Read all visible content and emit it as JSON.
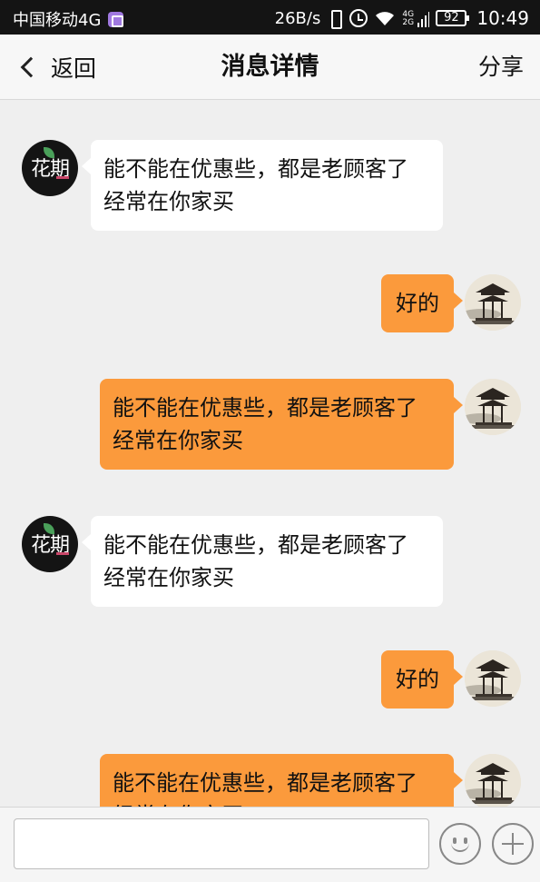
{
  "status_bar": {
    "carrier": "中国移动4G",
    "net_speed": "26B/s",
    "network_labels": [
      "4G",
      "2G"
    ],
    "battery": "92",
    "time": "10:49"
  },
  "nav": {
    "back_label": "返回",
    "title": "消息详情",
    "share_label": "分享"
  },
  "messages": [
    {
      "from": "shop",
      "lines": [
        "能不能在优惠些，都是老顾客了",
        "经常在你家买"
      ]
    },
    {
      "from": "me",
      "lines": [
        "好的"
      ]
    },
    {
      "from": "me",
      "lines": [
        "能不能在优惠些，都是老顾客了",
        "经常在你家买"
      ]
    },
    {
      "from": "shop",
      "lines": [
        "能不能在优惠些，都是老顾客了",
        "经常在你家买"
      ]
    },
    {
      "from": "me",
      "lines": [
        "好的"
      ]
    },
    {
      "from": "me",
      "lines": [
        "能不能在优惠些，都是老顾客了",
        "经常在你家买"
      ]
    }
  ],
  "shop_avatar_text": "花期",
  "input": {
    "value": "",
    "placeholder": ""
  },
  "colors": {
    "outgoing_bubble": "#fb9a3c",
    "incoming_bubble": "#ffffff",
    "background": "#efefef",
    "status_bar": "#141414"
  },
  "icons": [
    "back-chevron-icon",
    "emoji-icon",
    "plus-icon",
    "wifi-icon",
    "vibrate-icon",
    "alarm-icon",
    "battery-icon",
    "signal-icon"
  ]
}
